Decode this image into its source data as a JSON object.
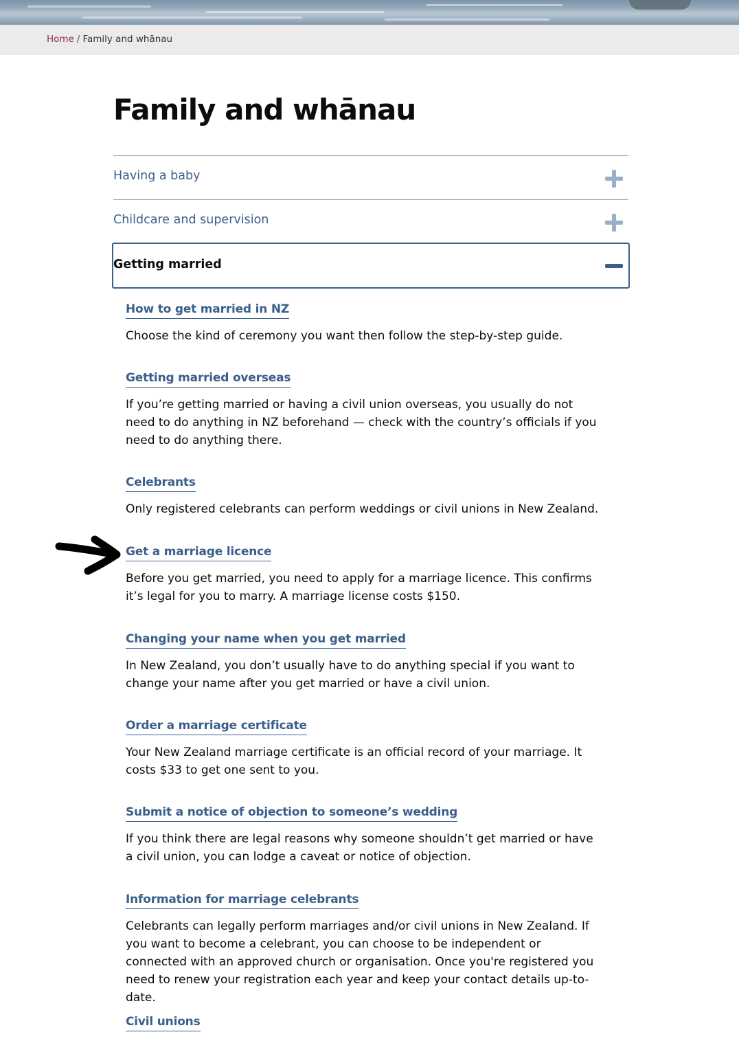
{
  "breadcrumb": {
    "home": "Home",
    "separator": "/",
    "current": "Family and whānau"
  },
  "page": {
    "title": "Family and whānau"
  },
  "accordion": {
    "collapsed_items": [
      {
        "label": "Having a baby",
        "icon": "plus-icon"
      },
      {
        "label": "Childcare and supervision",
        "icon": "plus-icon"
      }
    ],
    "expanded_item": {
      "label": "Getting married",
      "icon": "minus-icon"
    }
  },
  "links": [
    {
      "title": "How to get married in NZ",
      "description": "Choose the kind of ceremony you want then follow the step-by-step guide."
    },
    {
      "title": "Getting married overseas",
      "description": "If you’re getting married or having a civil union overseas, you usually do not need to do anything in NZ beforehand — check with the country’s officials if you need to do anything there."
    },
    {
      "title": "Celebrants",
      "description": "Only registered celebrants can perform weddings or civil unions in New Zealand."
    },
    {
      "title": "Get a marriage licence",
      "description": "Before you get married, you need to apply for a marriage licence. This confirms it’s legal for you to marry. A marriage license costs $150."
    },
    {
      "title": "Changing your name when you get married",
      "description": "In New Zealand, you don’t usually have to do anything special if you want to change your name after you get married or have a civil union."
    },
    {
      "title": "Order a marriage certificate",
      "description": "Your New Zealand marriage certificate is an official record of your marriage. It costs $33 to get one sent to you."
    },
    {
      "title": "Submit a notice of objection to someone’s wedding",
      "description": "If you think there are legal reasons why someone shouldn’t get married or have a civil union, you can lodge a caveat or notice of objection."
    },
    {
      "title": "Information for marriage celebrants",
      "description": "Celebrants can legally perform marriages and/or civil unions in New Zealand. If you want to become a celebrant, you can choose to be independent or connected with an approved church or organisation. Once you're registered you need to renew your registration each year and keep your contact details up-to-date."
    },
    {
      "title": "Civil unions",
      "description": ""
    }
  ],
  "annotation": {
    "icon": "arrow-annotation-icon",
    "color": "#000000"
  },
  "colors": {
    "link": "#3b5f8a",
    "breadcrumb_home": "#962847",
    "plus_icon": "#97afc9",
    "breadcrumb_bar": "#ebebeb"
  }
}
